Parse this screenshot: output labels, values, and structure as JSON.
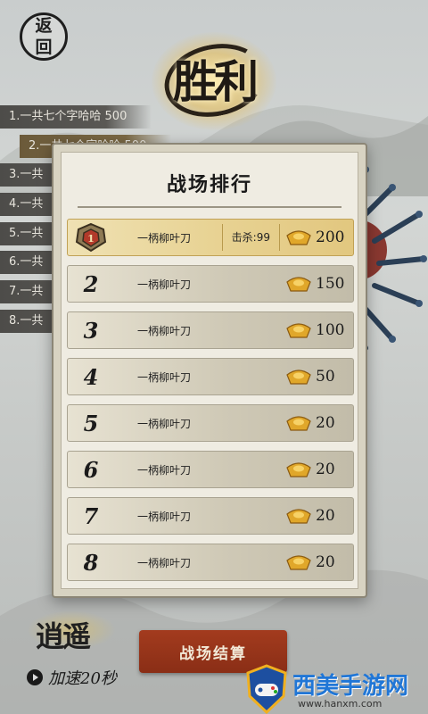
{
  "header": {
    "back_label_top": "返",
    "back_label_bottom": "回",
    "victory_text": "胜利"
  },
  "side_list": [
    "1.一共七个字哈哈 500",
    "2.一共七个字哈哈 500",
    "3.一共",
    "4.一共",
    "5.一共",
    "6.一共",
    "7.一共",
    "8.一共"
  ],
  "panel": {
    "title": "战场排行",
    "first": {
      "name": "一柄柳叶刀",
      "kills": "击杀:99",
      "reward": "200"
    },
    "rows": [
      {
        "rank": "2",
        "name": "一柄柳叶刀",
        "reward": "150"
      },
      {
        "rank": "3",
        "name": "一柄柳叶刀",
        "reward": "100"
      },
      {
        "rank": "4",
        "name": "一柄柳叶刀",
        "reward": "50"
      },
      {
        "rank": "5",
        "name": "一柄柳叶刀",
        "reward": "20"
      },
      {
        "rank": "6",
        "name": "一柄柳叶刀",
        "reward": "20"
      },
      {
        "rank": "7",
        "name": "一柄柳叶刀",
        "reward": "20"
      },
      {
        "rank": "8",
        "name": "一柄柳叶刀",
        "reward": "20"
      }
    ]
  },
  "footer": {
    "speed_logo": "逍遥",
    "speed_label": "加速20秒",
    "settle_label": "战场结算"
  },
  "watermark": {
    "title": "西美手游网",
    "url": "www.hanxm.com"
  },
  "colors": {
    "accent_red": "#9a3419",
    "gold": "#e2c77f",
    "watermark_blue": "#2076d6"
  }
}
